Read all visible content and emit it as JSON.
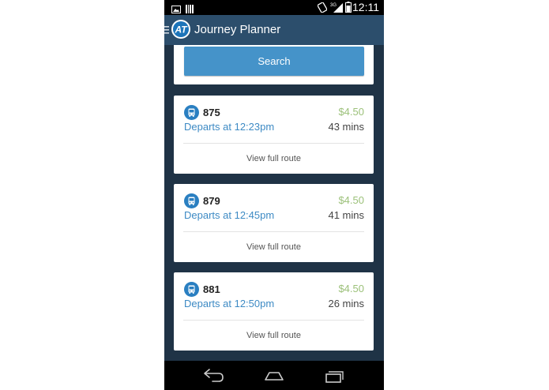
{
  "status_bar": {
    "time": "12:11",
    "network": "3G"
  },
  "action_bar": {
    "logo_text": "AT",
    "title": "Journey Planner"
  },
  "search": {
    "button_label": "Search"
  },
  "results": [
    {
      "route": "875",
      "fare": "$4.50",
      "departs": "Departs at 12:23pm",
      "duration": "43 mins",
      "link": "View full route"
    },
    {
      "route": "879",
      "fare": "$4.50",
      "departs": "Departs at 12:45pm",
      "duration": "41 mins",
      "link": "View full route"
    },
    {
      "route": "881",
      "fare": "$4.50",
      "departs": "Departs at 12:50pm",
      "duration": "26 mins",
      "link": "View full route"
    }
  ],
  "colors": {
    "action_bar": "#2c4e6c",
    "background": "#1f3346",
    "accent": "#4593c9",
    "fare": "#9cc17a",
    "depart_text": "#3d8ac4"
  },
  "icons": {
    "status": [
      "image-icon",
      "barcode-icon",
      "vibrate-icon",
      "signal-icon",
      "battery-icon"
    ],
    "nav": [
      "back-icon",
      "home-icon",
      "recent-apps-icon"
    ],
    "result": "bus-icon"
  }
}
